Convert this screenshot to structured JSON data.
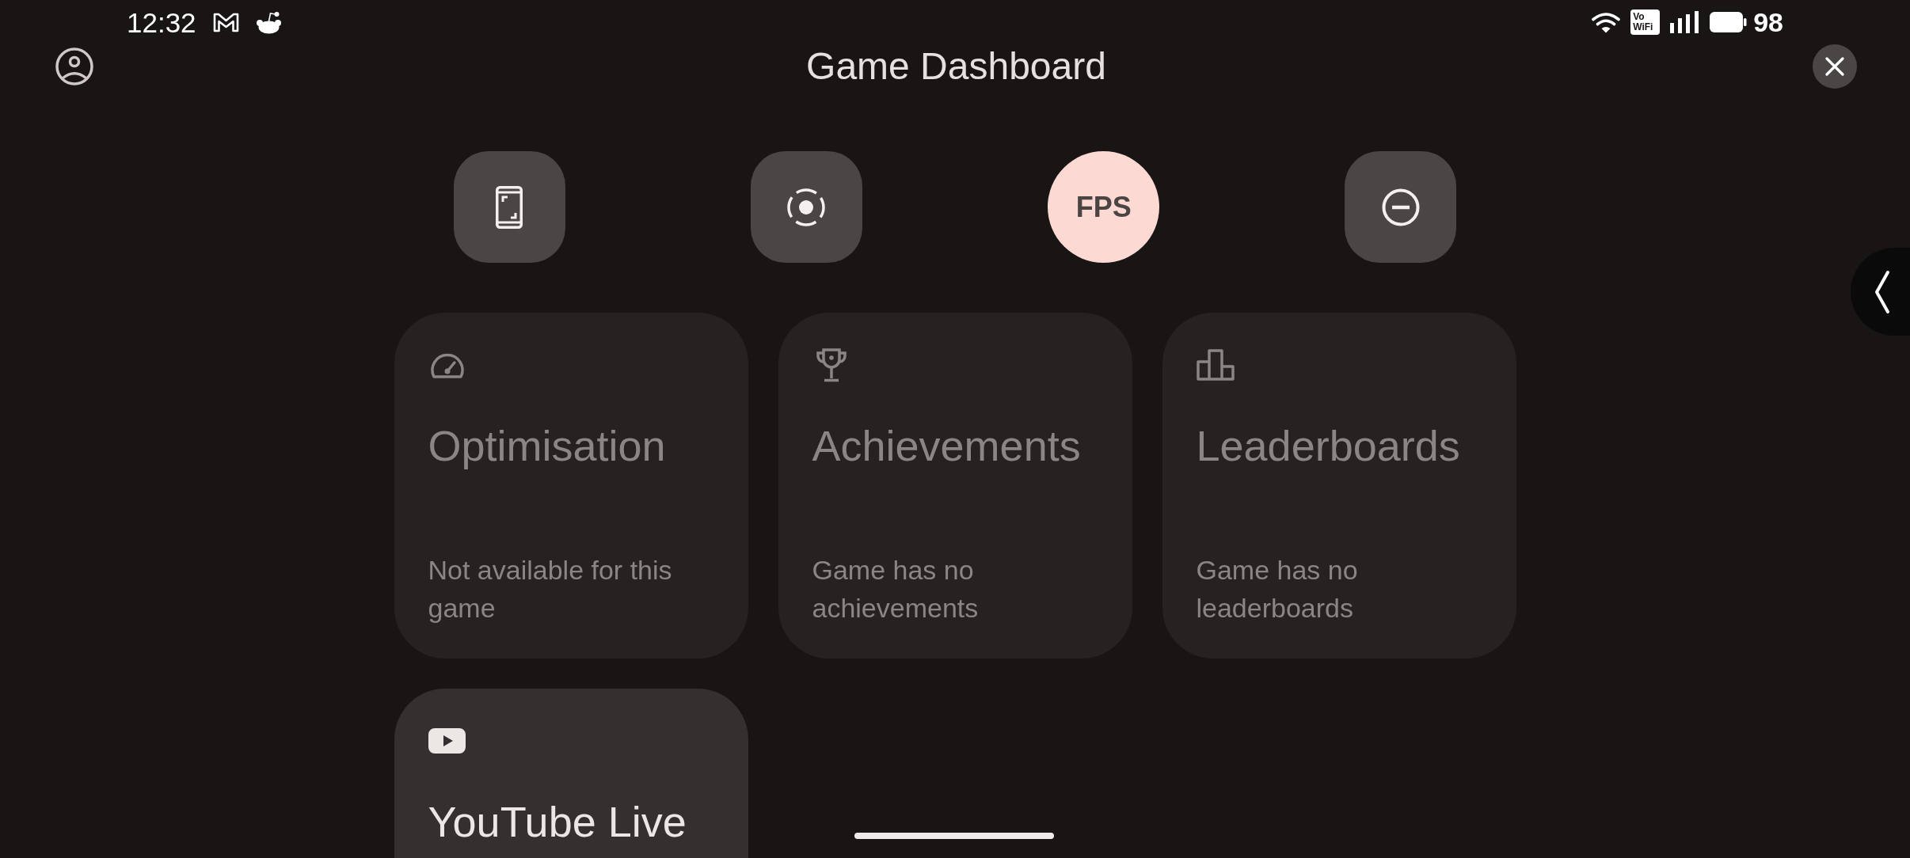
{
  "status_bar": {
    "time": "12:32",
    "network_badge": [
      "Vo",
      "WiFi"
    ],
    "battery": "98"
  },
  "header": {
    "title": "Game Dashboard"
  },
  "toggles": [
    {
      "on": false
    },
    {
      "on": false
    },
    {
      "label": "FPS",
      "on": true
    },
    {
      "on": false
    }
  ],
  "tiles": [
    {
      "title": "Optimisation",
      "subtitle": "Not available for this game",
      "disabled": true
    },
    {
      "title": "Achievements",
      "subtitle": "Game has no achievements",
      "disabled": true
    },
    {
      "title": "Leaderboards",
      "subtitle": "Game has no leaderboards",
      "disabled": true
    },
    {
      "title": "YouTube Live",
      "disabled": false
    }
  ]
}
